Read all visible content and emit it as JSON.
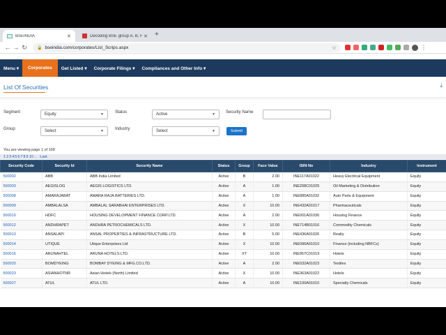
{
  "browser": {
    "tabs": [
      {
        "title": "BSEINDIA",
        "active": true
      },
      {
        "title": "Decoding BSE group A, B, F, T...",
        "active": false
      }
    ],
    "url": "bseindia.com/corporates/List_Scrips.aspx"
  },
  "nav": {
    "items": [
      "Menu ▾",
      "Corporates",
      "Get Listed ▾",
      "Corporate Filings ▾",
      "Compliances and Other Info ▾"
    ]
  },
  "page": {
    "title": "List Of Securities"
  },
  "filters": {
    "segment_label": "Segment",
    "segment_value": "Equity",
    "status_label": "Status",
    "status_value": "Active",
    "security_name_label": "Security Name",
    "group_label": "Group",
    "group_value": "Select",
    "industry_label": "Industry",
    "industry_value": "Select",
    "submit_label": "Submit"
  },
  "info": {
    "viewing": "You are viewing page 1 of 168",
    "pages": [
      "1",
      "2",
      "3",
      "4",
      "5",
      "6",
      "7",
      "8",
      "9",
      "10",
      "...",
      "Last"
    ]
  },
  "table": {
    "headers": [
      "Security Code",
      "Security Id",
      "Security Name",
      "Status",
      "Group",
      "Face Value",
      "ISIN No",
      "Industry",
      "Instrument"
    ],
    "rows": [
      [
        "500002",
        "ABB",
        "ABB India Limited",
        "Active",
        "B",
        "2.00",
        "INE117A01022",
        "Heavy Electrical Equipment",
        "Equity"
      ],
      [
        "500003",
        "AEGISLOG",
        "AEGIS LOGISTICS LTD.",
        "Active",
        "A",
        "1.00",
        "INE208C01025",
        "Oil Marketing & Distribution",
        "Equity"
      ],
      [
        "500008",
        "AMARAJABAT",
        "AMARA RAJA BATTERIES LTD.",
        "Active",
        "A",
        "1.00",
        "INE885A01032",
        "Auto Parts & Equipment",
        "Equity"
      ],
      [
        "500009",
        "AMBALALSA",
        "AMBALAL SARABHAI ENTERPRISES LTD.",
        "Active",
        "X",
        "10.00",
        "INE432A01017",
        "Pharmaceuticals",
        "Equity"
      ],
      [
        "500010",
        "HDFC",
        "HOUSING DEVELOPMENT FINANCE CORP.LTD.",
        "Active",
        "A",
        "2.00",
        "INE001A01036",
        "Housing Finance",
        "Equity"
      ],
      [
        "500012",
        "ANDHRAPET",
        "ANDHRA PETROCHEMICALS LTD.",
        "Active",
        "X",
        "10.00",
        "INE714B01016",
        "Commodity Chemicals",
        "Equity"
      ],
      [
        "500013",
        "ANSALAPI",
        "ANSAL PROPERTIES & INFRASTRUCTURE LTD.",
        "Active",
        "B",
        "5.00",
        "INE436A01026",
        "Realty",
        "Equity"
      ],
      [
        "500014",
        "UTIQUE",
        "Utique Enterprises Ltd",
        "Active",
        "X",
        "10.00",
        "INE096A01010",
        "Finance (including NBFCs)",
        "Equity"
      ],
      [
        "500016",
        "ARUNAHTEL",
        "ARUNA HOTELS LTD.",
        "Active",
        "XT",
        "10.00",
        "INE957C01019",
        "Hotels",
        "Equity"
      ],
      [
        "500020",
        "BOMDYEING",
        "BOMBAY DYEING & MFG.CO.LTD.",
        "Active",
        "A",
        "2.00",
        "INE032A01023",
        "Textiles",
        "Equity"
      ],
      [
        "500023",
        "ASIANHOTNR",
        "Asian Hotels (North) Limited",
        "Active",
        "X",
        "10.00",
        "INE363A01022",
        "Hotels",
        "Equity"
      ],
      [
        "500027",
        "ATUL",
        "ATUL LTD.",
        "Active",
        "A",
        "10.00",
        "INE100A01010",
        "Specialty Chemicals",
        "Equity"
      ]
    ]
  }
}
